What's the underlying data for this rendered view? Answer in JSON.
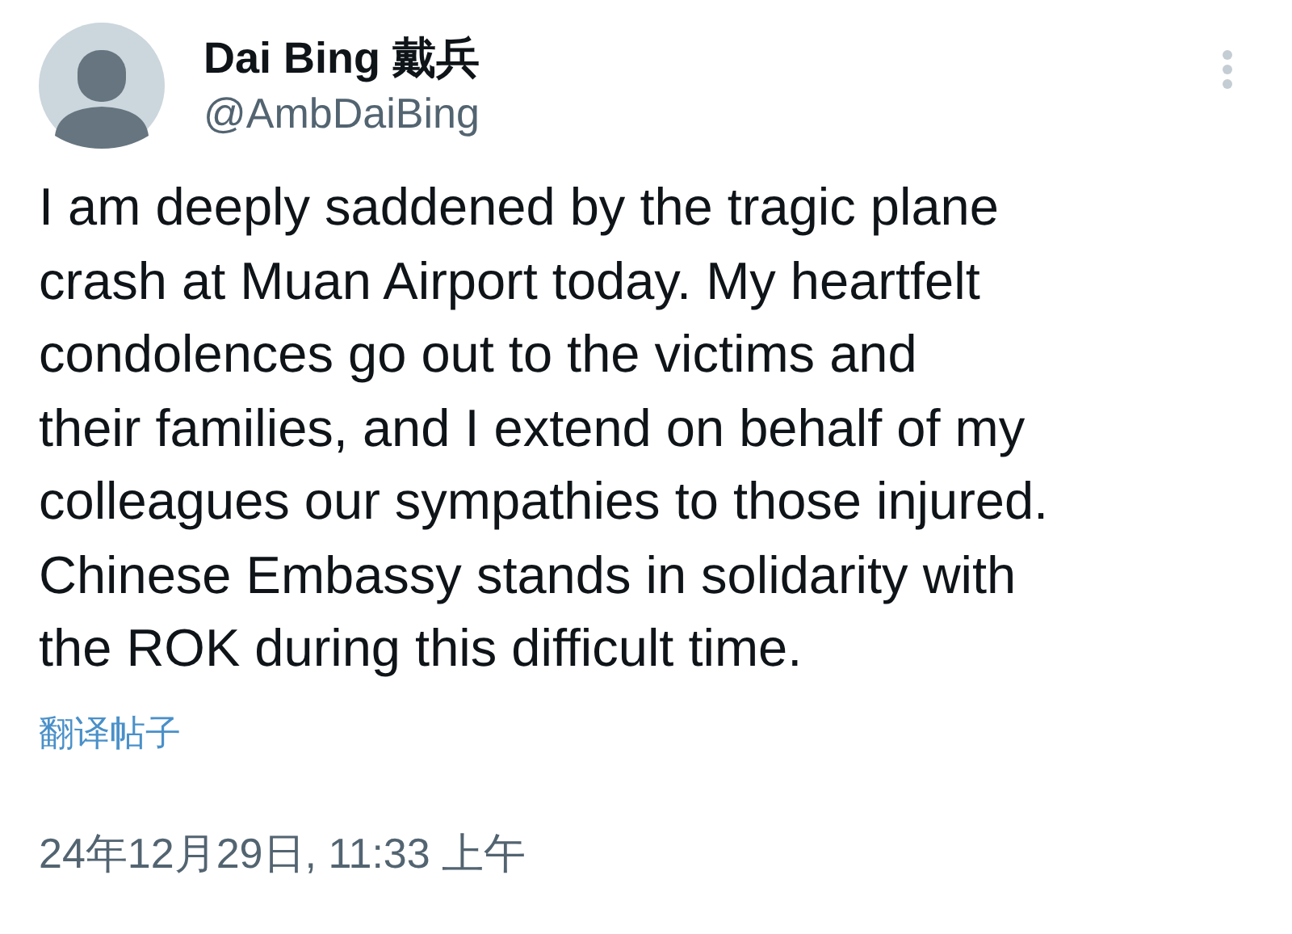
{
  "post": {
    "author_name": "Dai Bing 戴兵",
    "handle": "@AmbDaiBing",
    "text": "I am deeply saddened by the tragic plane\ncrash at Muan Airport today. My heartfelt\ncondolences go out to the victims and\ntheir families, and I extend on behalf of my\ncolleagues our sympathies to those injured.\nChinese Embassy stands in solidarity with\nthe ROK during this difficult time.",
    "translate_link": "翻译帖子",
    "timestamp": "24年12月29日, 11:33 上午"
  }
}
